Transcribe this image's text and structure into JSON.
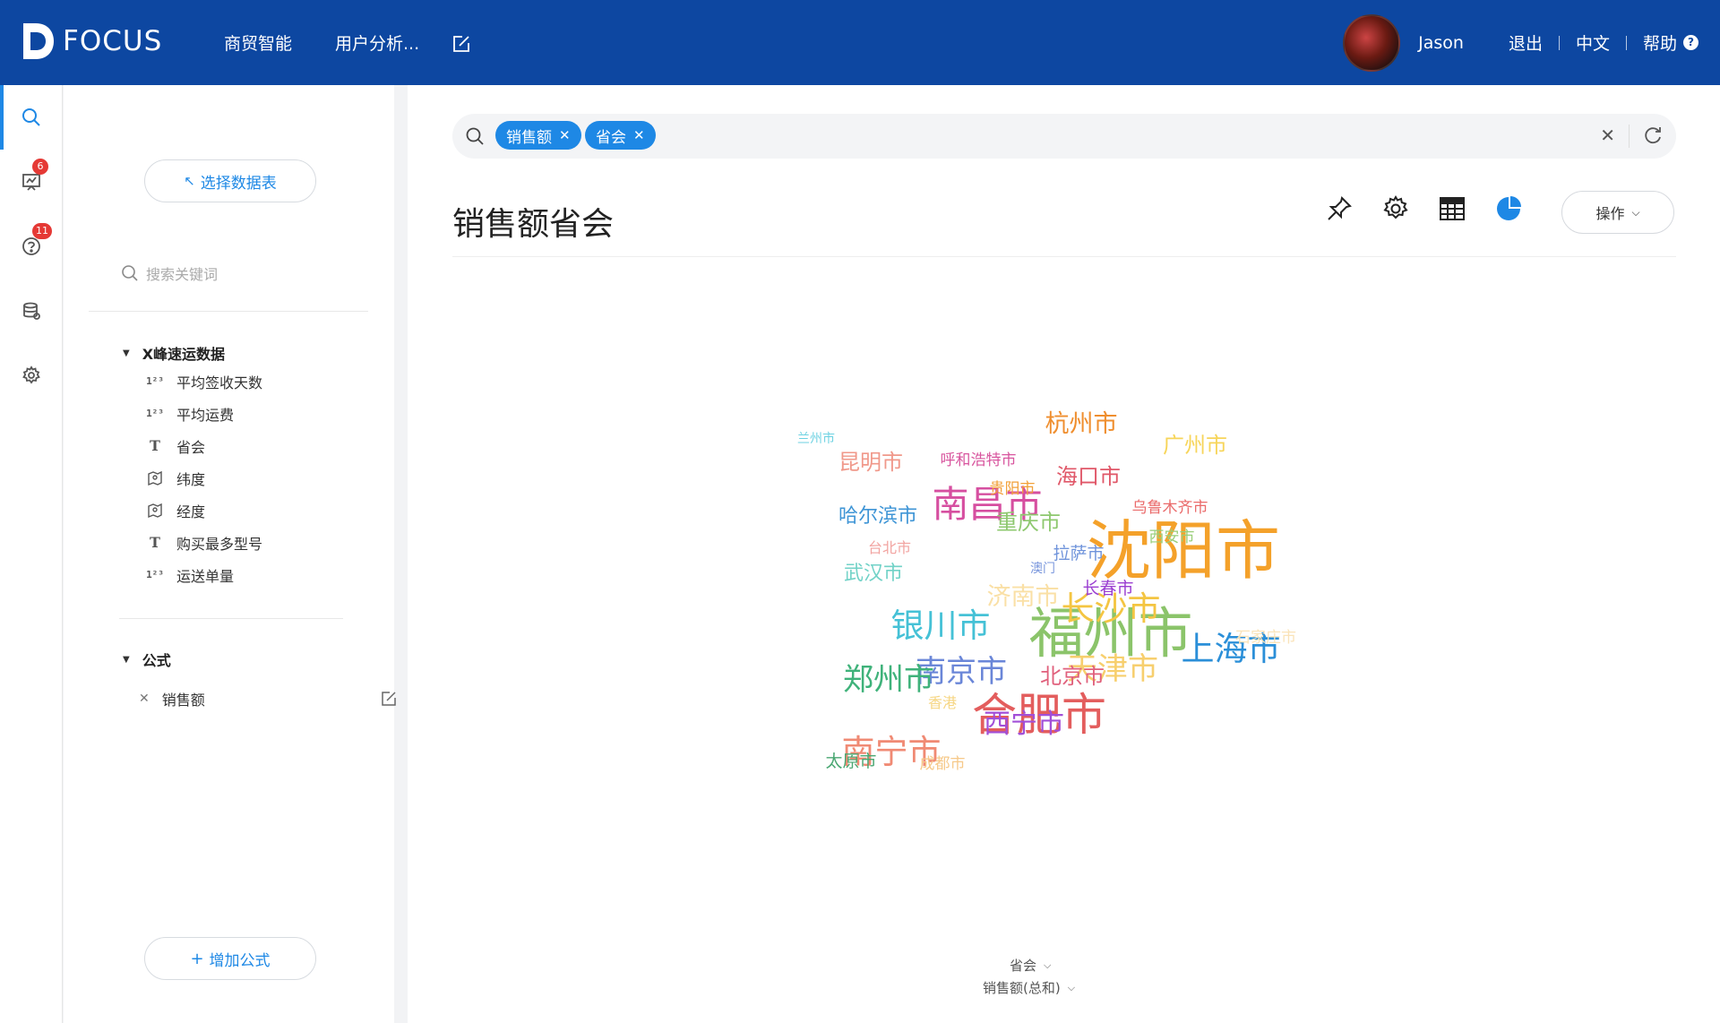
{
  "app": {
    "logo_text": "FOCUS"
  },
  "topnav": {
    "items": [
      "商贸智能",
      "用户分析..."
    ]
  },
  "user": {
    "name": "Jason",
    "logout": "退出",
    "language": "中文",
    "help": "帮助",
    "help_mark": "?"
  },
  "rail": {
    "badges": {
      "dashboard": "6",
      "questions": "11"
    }
  },
  "sidebar": {
    "choose_table": "选择数据表",
    "search_placeholder": "搜索关键词",
    "dataset_name": "X峰速运数据",
    "fields": [
      {
        "type_icon": "123",
        "label": "平均签收天数"
      },
      {
        "type_icon": "123",
        "label": "平均运费"
      },
      {
        "type_icon": "T",
        "label": "省会"
      },
      {
        "type_icon": "geo",
        "label": "纬度"
      },
      {
        "type_icon": "geo",
        "label": "经度"
      },
      {
        "type_icon": "T",
        "label": "购买最多型号"
      },
      {
        "type_icon": "123",
        "label": "运送单量"
      }
    ],
    "formula_heading": "公式",
    "formulas": [
      {
        "label": "销售额"
      }
    ],
    "add_formula": "增加公式"
  },
  "search": {
    "tags": [
      "销售额",
      "省会"
    ]
  },
  "main": {
    "title": "销售额省会",
    "operations_label": "操作"
  },
  "axis": {
    "dimension": "省会",
    "measure": "销售额(总和)"
  },
  "chart_data": {
    "type": "wordcloud",
    "dimension": "省会",
    "measure": "销售额(总和)",
    "words": [
      {
        "text": "沈阳市",
        "weight": 10,
        "color": "#f4a12a"
      },
      {
        "text": "福州市",
        "weight": 9,
        "color": "#8bc46a"
      },
      {
        "text": "合肥市",
        "weight": 8,
        "color": "#e35d5d"
      },
      {
        "text": "南昌市",
        "weight": 7,
        "color": "#d64fa0"
      },
      {
        "text": "长沙市",
        "weight": 6.5,
        "color": "#f4c542"
      },
      {
        "text": "银川市",
        "weight": 6.5,
        "color": "#45c1d6"
      },
      {
        "text": "上海市",
        "weight": 6.5,
        "color": "#2b8fd8"
      },
      {
        "text": "南宁市",
        "weight": 6.5,
        "color": "#f08a74"
      },
      {
        "text": "南京市",
        "weight": 6,
        "color": "#6a86d8"
      },
      {
        "text": "郑州市",
        "weight": 6,
        "color": "#3fb27a"
      },
      {
        "text": "天津市",
        "weight": 6,
        "color": "#f7cf6e"
      },
      {
        "text": "西宁市",
        "weight": 5.5,
        "color": "#a24fd8"
      },
      {
        "text": "杭州市",
        "weight": 5,
        "color": "#ef8e2e"
      },
      {
        "text": "济南市",
        "weight": 5,
        "color": "#fae0a6"
      },
      {
        "text": "海口市",
        "weight": 4.5,
        "color": "#e05768"
      },
      {
        "text": "昆明市",
        "weight": 4.5,
        "color": "#f0988a"
      },
      {
        "text": "重庆市",
        "weight": 4.5,
        "color": "#8ec86f"
      },
      {
        "text": "广州市",
        "weight": 4.5,
        "color": "#f7d55a"
      },
      {
        "text": "北京市",
        "weight": 4.5,
        "color": "#e0607c"
      },
      {
        "text": "武汉市",
        "weight": 4,
        "color": "#71d2c7"
      },
      {
        "text": "哈尔滨市",
        "weight": 4,
        "color": "#3f95d6"
      },
      {
        "text": "拉萨市",
        "weight": 3.5,
        "color": "#7094db"
      },
      {
        "text": "长春市",
        "weight": 3.5,
        "color": "#9b3fd1"
      },
      {
        "text": "太原市",
        "weight": 3.5,
        "color": "#4aa772"
      },
      {
        "text": "乌鲁木齐市",
        "weight": 3,
        "color": "#ea6a6a"
      },
      {
        "text": "呼和浩特市",
        "weight": 3,
        "color": "#d8559e"
      },
      {
        "text": "贵阳市",
        "weight": 3,
        "color": "#f2a13a"
      },
      {
        "text": "西安市",
        "weight": 3,
        "color": "#99ce79"
      },
      {
        "text": "成都市",
        "weight": 3,
        "color": "#f6c98a"
      },
      {
        "text": "石家庄市",
        "weight": 3,
        "color": "#fae3b8"
      },
      {
        "text": "台北市",
        "weight": 2.5,
        "color": "#f2a3a0"
      },
      {
        "text": "香港",
        "weight": 2.5,
        "color": "#f6d683"
      },
      {
        "text": "兰州市",
        "weight": 2,
        "color": "#6dd2e2"
      },
      {
        "text": "澳门",
        "weight": 2,
        "color": "#7a97dd"
      }
    ]
  }
}
